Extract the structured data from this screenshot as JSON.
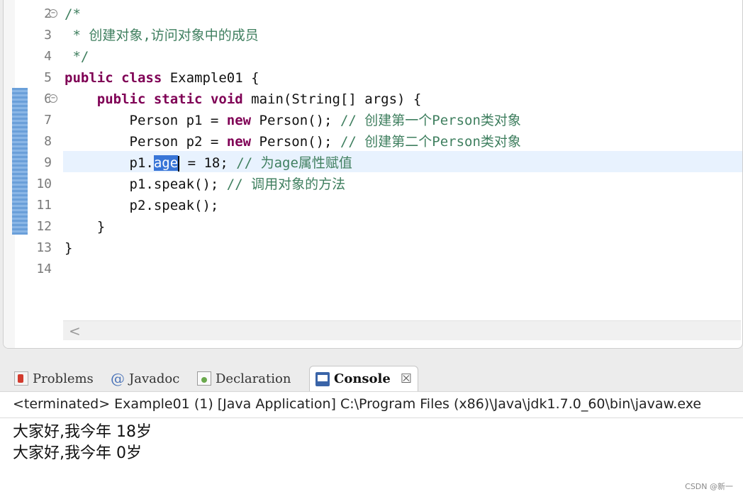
{
  "editor": {
    "lines": [
      {
        "num": "2",
        "fold": true,
        "parts": [
          {
            "t": "/*",
            "c": "cm"
          }
        ]
      },
      {
        "num": "3",
        "fold": false,
        "parts": [
          {
            "t": " * 创建对象,访问对象中的成员",
            "c": "cm"
          }
        ]
      },
      {
        "num": "4",
        "fold": false,
        "parts": [
          {
            "t": " */",
            "c": "cm"
          }
        ]
      },
      {
        "num": "5",
        "fold": false,
        "parts": [
          {
            "t": "public",
            "c": "kw"
          },
          {
            "t": " "
          },
          {
            "t": "class",
            "c": "kw"
          },
          {
            "t": " Example01 {"
          }
        ]
      },
      {
        "num": "6",
        "fold": true,
        "parts": [
          {
            "t": "    "
          },
          {
            "t": "public",
            "c": "kw"
          },
          {
            "t": " "
          },
          {
            "t": "static",
            "c": "kw"
          },
          {
            "t": " "
          },
          {
            "t": "void",
            "c": "kw"
          },
          {
            "t": " main(String[] args) {"
          }
        ]
      },
      {
        "num": "7",
        "fold": false,
        "parts": [
          {
            "t": "        Person p1 = "
          },
          {
            "t": "new",
            "c": "kw"
          },
          {
            "t": " Person(); "
          },
          {
            "t": "// 创建第一个Person类对象",
            "c": "cm"
          }
        ]
      },
      {
        "num": "8",
        "fold": false,
        "parts": [
          {
            "t": "        Person p2 = "
          },
          {
            "t": "new",
            "c": "kw"
          },
          {
            "t": " Person(); "
          },
          {
            "t": "// 创建第二个Person类对象",
            "c": "cm"
          }
        ]
      },
      {
        "num": "9",
        "fold": false,
        "parts": [
          {
            "t": "        p1."
          },
          {
            "t": "age",
            "c": "sel"
          },
          {
            "t": "",
            "c": "caret"
          },
          {
            "t": " = 18; "
          },
          {
            "t": "// 为age属性赋值",
            "c": "cm"
          }
        ]
      },
      {
        "num": "10",
        "fold": false,
        "parts": [
          {
            "t": "        p1.speak(); "
          },
          {
            "t": "// 调用对象的方法",
            "c": "cm"
          }
        ]
      },
      {
        "num": "11",
        "fold": false,
        "parts": [
          {
            "t": "        p2.speak();"
          }
        ]
      },
      {
        "num": "12",
        "fold": false,
        "parts": [
          {
            "t": "    }"
          }
        ]
      },
      {
        "num": "13",
        "fold": false,
        "parts": [
          {
            "t": "}"
          }
        ]
      },
      {
        "num": "14",
        "fold": false,
        "parts": []
      }
    ],
    "scroll_left_glyph": "<"
  },
  "tabs": [
    {
      "label": "Problems",
      "icon": "problems-icon"
    },
    {
      "label": "Javadoc",
      "icon": "javadoc-icon"
    },
    {
      "label": "Declaration",
      "icon": "declaration-icon"
    },
    {
      "label": "Console",
      "icon": "console-icon",
      "active": true
    }
  ],
  "tab_close_glyph": "☒",
  "console": {
    "header": "<terminated> Example01 (1) [Java Application] C:\\Program Files (x86)\\Java\\jdk1.7.0_60\\bin\\javaw.exe",
    "output": [
      "大家好,我今年 18岁",
      "大家好,我今年 0岁"
    ]
  },
  "watermark": "CSDN @新一",
  "colors": {
    "keyword": "#7f0055",
    "comment": "#3f7f5f",
    "selection": "#3875d7",
    "current_line": "#e8f2fe"
  }
}
